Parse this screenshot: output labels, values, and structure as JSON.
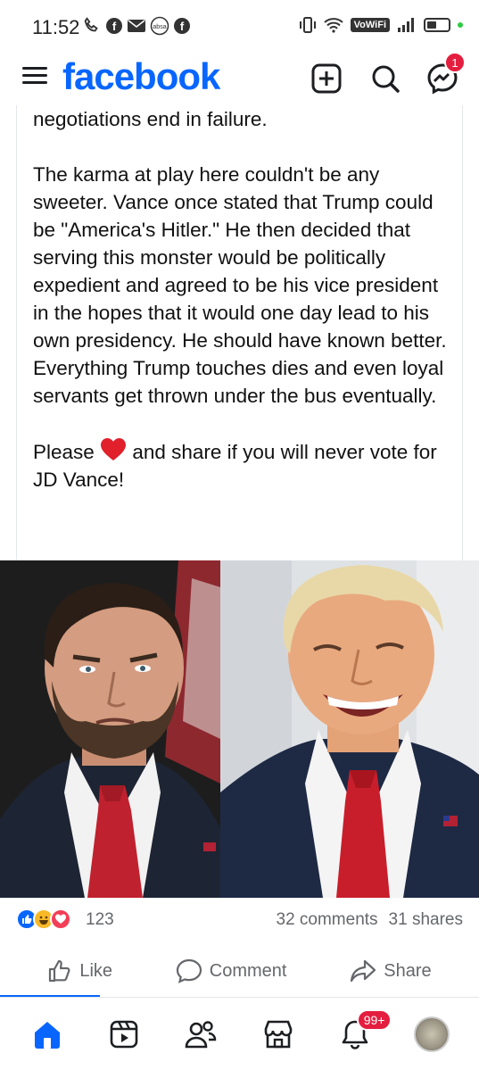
{
  "status_bar": {
    "time": "11:52",
    "network": "VoWiFi"
  },
  "header": {
    "brand": "facebook",
    "messenger_badge": "1"
  },
  "post": {
    "paragraphs": [
      "negotiations end in failure.",
      "The karma at play here couldn't be any sweeter. Vance once stated that Trump could be \"America's Hitler.\" He then decided that serving this monster would be politically expedient and agreed to be his vice president in the hopes that it would one day lead to his own presidency. He should have known better. Everything Trump touches dies and even loyal servants get thrown under the bus eventually."
    ],
    "cta_before": "Please",
    "cta_after": "and share if you will never vote for JD Vance!"
  },
  "engagement": {
    "reaction_count": "123",
    "comments": "32 comments",
    "shares": "31 shares"
  },
  "actions": {
    "like": "Like",
    "comment": "Comment",
    "share": "Share"
  },
  "bottom_nav": {
    "notifications_badge": "99+"
  },
  "colors": {
    "brand": "#0866ff",
    "badge": "#e41e3f",
    "secondary_text": "#65676b"
  }
}
